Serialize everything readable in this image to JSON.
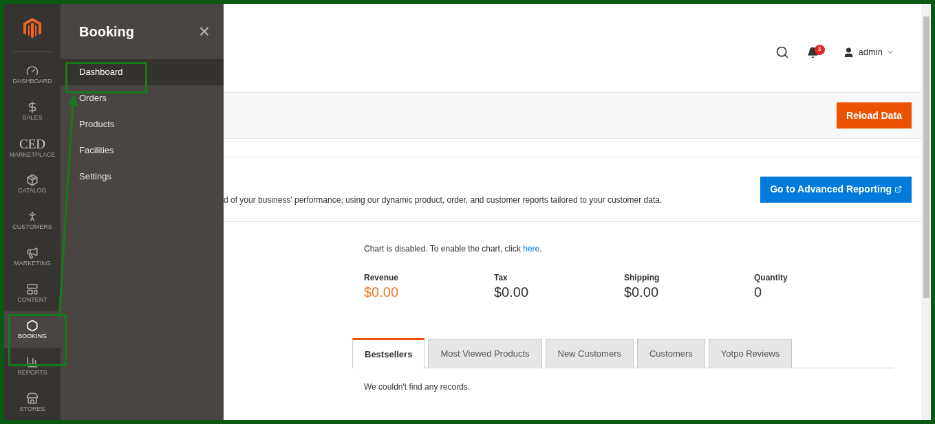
{
  "sidebar": {
    "items": [
      {
        "label": "DASHBOARD",
        "selected": false
      },
      {
        "label": "SALES",
        "selected": false
      },
      {
        "icon_text": "CED",
        "label": "MARKETPLACE",
        "selected": false
      },
      {
        "label": "CATALOG",
        "selected": false
      },
      {
        "label": "CUSTOMERS",
        "selected": false
      },
      {
        "label": "MARKETING",
        "selected": false
      },
      {
        "label": "CONTENT",
        "selected": false
      },
      {
        "label": "BOOKING",
        "selected": true
      },
      {
        "label": "REPORTS",
        "selected": false
      },
      {
        "label": "STORES",
        "selected": false
      }
    ]
  },
  "submenu": {
    "title": "Booking",
    "close": "×",
    "items": [
      {
        "label": "Dashboard",
        "selected": true
      },
      {
        "label": "Orders",
        "selected": false
      },
      {
        "label": "Products",
        "selected": false
      },
      {
        "label": "Facilities",
        "selected": false
      },
      {
        "label": "Settings",
        "selected": false
      }
    ]
  },
  "header": {
    "notifications": "3",
    "user": "admin"
  },
  "reload_button": "Reload Data",
  "advanced": {
    "description": "d of your business' performance, using our dynamic product, order, and customer reports tailored to your customer data.",
    "button": "Go to Advanced Reporting"
  },
  "chart_notice": {
    "before": "Chart is disabled. To enable the chart, click ",
    "link": "here",
    "after": "."
  },
  "totals": [
    {
      "label": "Revenue",
      "value": "$0.00",
      "highlight": true
    },
    {
      "label": "Tax",
      "value": "$0.00",
      "highlight": false
    },
    {
      "label": "Shipping",
      "value": "$0.00",
      "highlight": false
    },
    {
      "label": "Quantity",
      "value": "0",
      "highlight": false
    }
  ],
  "tabs": [
    {
      "label": "Bestsellers",
      "selected": true
    },
    {
      "label": "Most Viewed Products",
      "selected": false
    },
    {
      "label": "New Customers",
      "selected": false
    },
    {
      "label": "Customers",
      "selected": false
    },
    {
      "label": "Yotpo Reviews",
      "selected": false
    }
  ],
  "empty_message": "We couldn't find any records."
}
